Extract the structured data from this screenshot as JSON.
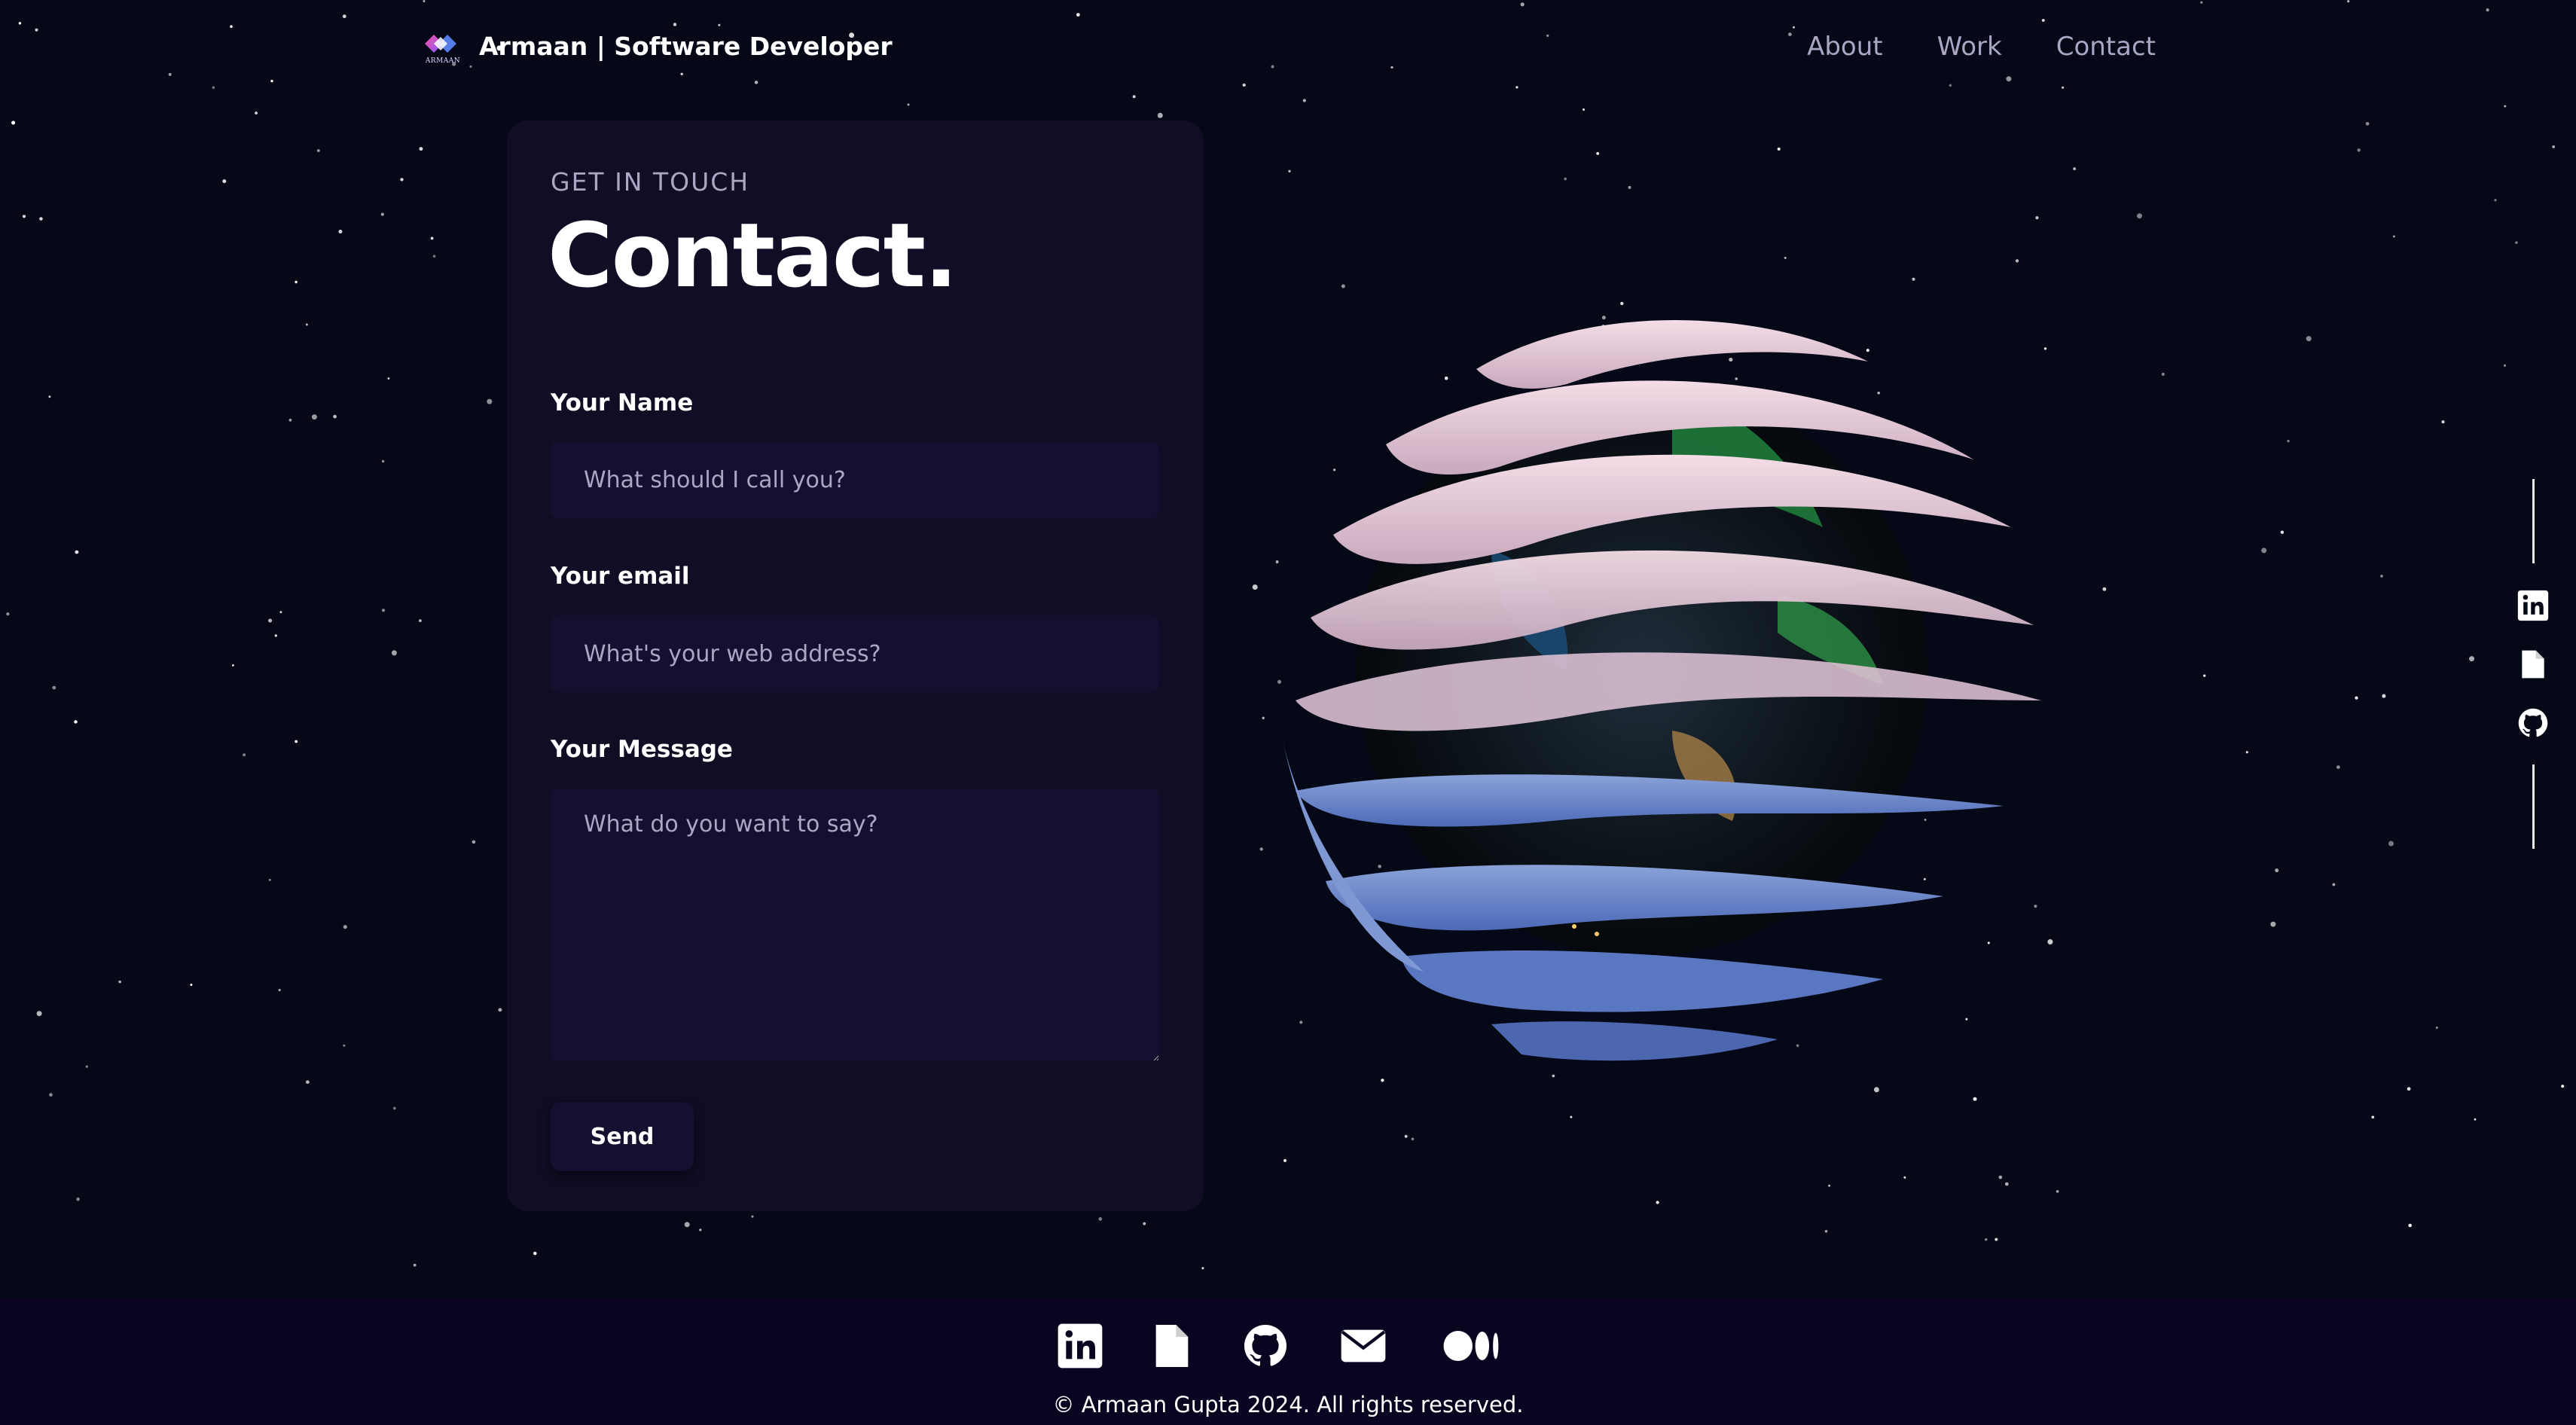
{
  "nav": {
    "logo_text": "ARMAAN",
    "brand": "Armaan | Software Developer",
    "links": [
      {
        "label": "About"
      },
      {
        "label": "Work"
      },
      {
        "label": "Contact"
      }
    ]
  },
  "contact": {
    "eyebrow": "GET IN TOUCH",
    "heading": "Contact.",
    "name_label": "Your Name",
    "name_placeholder": "What should I call you?",
    "email_label": "Your email",
    "email_placeholder": "What's your web address?",
    "message_label": "Your Message",
    "message_placeholder": "What do you want to say?",
    "send_label": "Send"
  },
  "side_social": [
    "linkedin-icon",
    "document-icon",
    "github-icon"
  ],
  "footer": {
    "icons": [
      "linkedin-icon",
      "document-icon",
      "github-icon",
      "mail-icon",
      "medium-icon"
    ],
    "copyright": "© Armaan Gupta 2024. All rights reserved."
  },
  "colors": {
    "background": "#050816",
    "card": "#100d25",
    "field": "#151030",
    "secondary_text": "#aaa6c3",
    "footer": "#0b0420"
  }
}
